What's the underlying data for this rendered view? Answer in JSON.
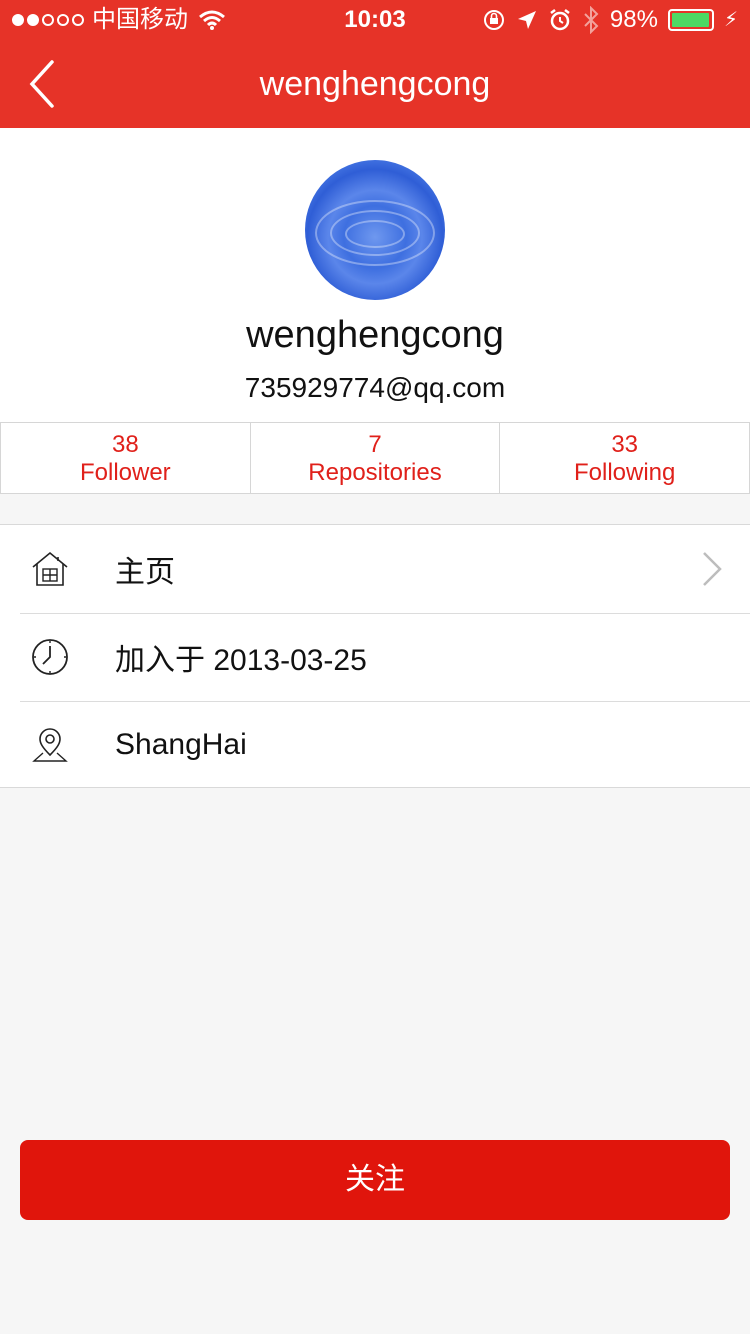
{
  "status_bar": {
    "carrier": "中国移动",
    "time": "10:03",
    "battery_percent": "98%",
    "battery_level": 0.98,
    "icons": [
      "wifi-icon",
      "rotation-lock-icon",
      "location-icon",
      "alarm-icon",
      "bluetooth-icon",
      "battery-icon",
      "charging-icon"
    ]
  },
  "nav": {
    "title": "wenghengcong",
    "back_icon": "chevron-left-icon"
  },
  "profile": {
    "avatar_icon": "avatar-water-drop",
    "username": "wenghengcong",
    "email": "735929774@qq.com"
  },
  "stats": [
    {
      "count": "38",
      "label": "Follower"
    },
    {
      "count": "7",
      "label": "Repositories"
    },
    {
      "count": "33",
      "label": "Following"
    }
  ],
  "info_list": [
    {
      "icon": "home-icon",
      "label": "主页",
      "has_chevron": true
    },
    {
      "icon": "clock-icon",
      "label": "加入于 2013-03-25",
      "has_chevron": false
    },
    {
      "icon": "location-pin-icon",
      "label": "ShangHai",
      "has_chevron": false
    }
  ],
  "follow_button": {
    "label": "关注"
  },
  "colors": {
    "brand_red": "#e63328",
    "stat_red": "#e0201a",
    "button_red": "#e0150c",
    "background": "#f6f6f6"
  }
}
